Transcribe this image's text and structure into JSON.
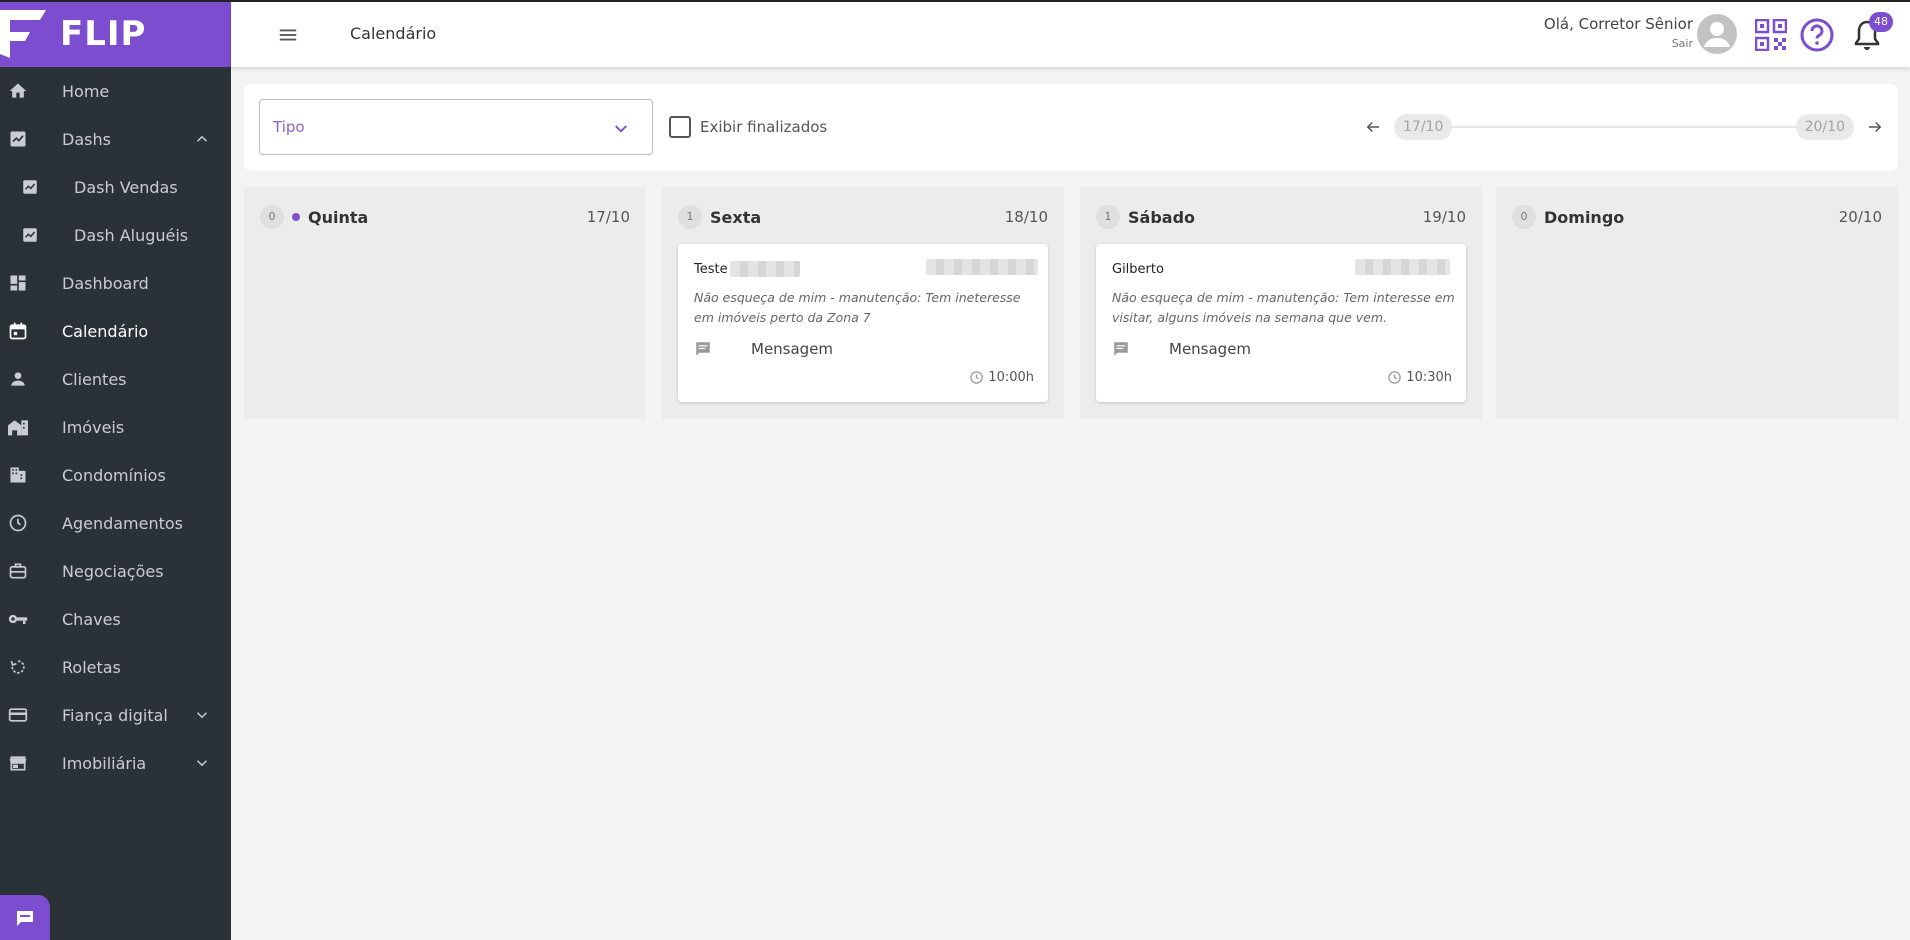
{
  "app": {
    "brand": "FLIP",
    "accent": "#7c4dcf",
    "sidebar_bg": "#2b3237"
  },
  "sidebar": {
    "items": [
      {
        "label": "Home",
        "icon": "home-icon"
      },
      {
        "label": "Dashs",
        "icon": "chart-icon",
        "expanded": true
      },
      {
        "label": "Dash Vendas",
        "icon": "chart-icon",
        "sub": true
      },
      {
        "label": "Dash Aluguéis",
        "icon": "chart-icon",
        "sub": true
      },
      {
        "label": "Dashboard",
        "icon": "dashboard-icon"
      },
      {
        "label": "Calendário",
        "icon": "calendar-icon",
        "active": true
      },
      {
        "label": "Clientes",
        "icon": "person-icon"
      },
      {
        "label": "Imóveis",
        "icon": "building-icon"
      },
      {
        "label": "Condomínios",
        "icon": "apartment-icon"
      },
      {
        "label": "Agendamentos",
        "icon": "clock-icon"
      },
      {
        "label": "Negociações",
        "icon": "briefcase-icon"
      },
      {
        "label": "Chaves",
        "icon": "key-icon"
      },
      {
        "label": "Roletas",
        "icon": "rotate-icon"
      },
      {
        "label": "Fiança digital",
        "icon": "card-icon",
        "collapsible": true
      },
      {
        "label": "Imobiliária",
        "icon": "store-icon",
        "collapsible": true
      }
    ]
  },
  "header": {
    "title": "Calendário",
    "greeting": "Olá, Corretor Sênior",
    "logout": "Sair",
    "notifications": "48"
  },
  "filter": {
    "type_placeholder": "Tipo",
    "show_finished_label": "Exibir finalizados",
    "show_finished_checked": false,
    "range_start": "17/10",
    "range_end": "20/10"
  },
  "columns": [
    {
      "count": "0",
      "day": "Quinta",
      "date": "17/10",
      "today": true,
      "cards": []
    },
    {
      "count": "1",
      "day": "Sexta",
      "date": "18/10",
      "today": false,
      "cards": [
        {
          "name": "Teste",
          "note": "Não esqueça de mim - manutenção: Tem ineteresse em imóveis perto da Zona 7",
          "type": "Mensagem",
          "time": "10:00h"
        }
      ]
    },
    {
      "count": "1",
      "day": "Sábado",
      "date": "19/10",
      "today": false,
      "cards": [
        {
          "name": "Gilberto",
          "note": "Não esqueça de mim - manutenção: Tem interesse em visitar, alguns imóveis na semana que vem.",
          "type": "Mensagem",
          "time": "10:30h"
        }
      ]
    },
    {
      "count": "0",
      "day": "Domingo",
      "date": "20/10",
      "today": false,
      "cards": []
    }
  ]
}
